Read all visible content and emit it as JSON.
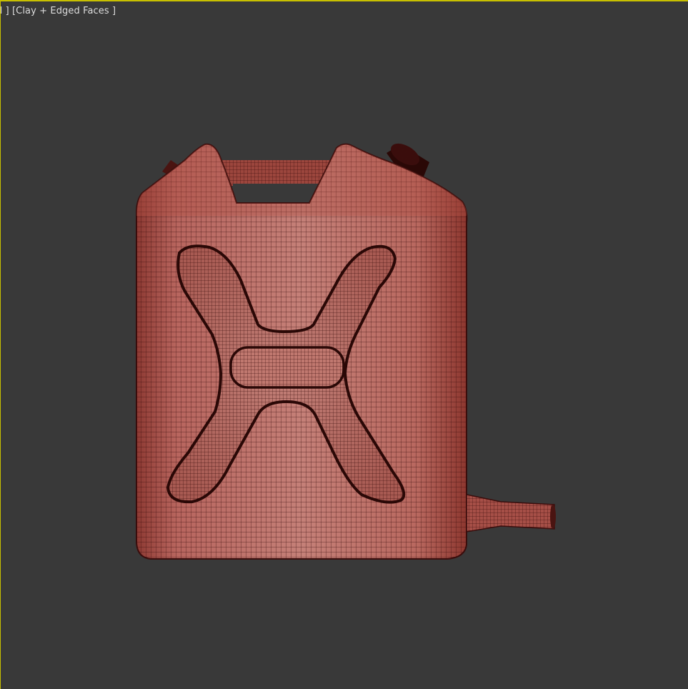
{
  "viewport": {
    "label_prefix": "d ]",
    "shading_mode": "[Clay + Edged Faces ]",
    "active_border_color": "#c8c000",
    "background_color": "#393939"
  },
  "model": {
    "object": "jerry-can",
    "clay_color": "#a24a42",
    "wire_color": "#3a0d0c"
  }
}
